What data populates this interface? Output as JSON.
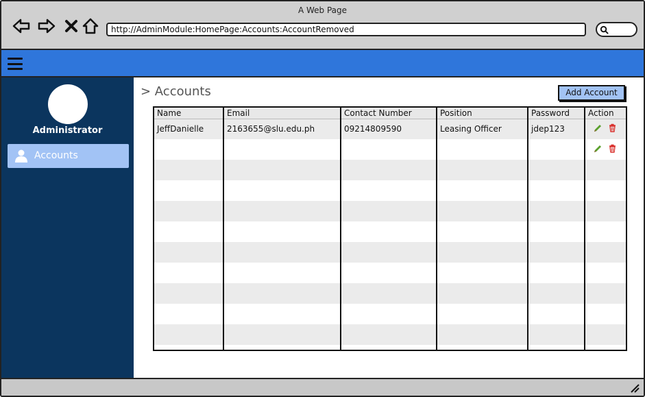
{
  "window": {
    "title": "A Web Page"
  },
  "browser": {
    "url": "http://AdminModule:HomePage:Accounts:AccountRemoved",
    "icons": [
      "back-arrow-icon",
      "forward-arrow-icon",
      "close-x-icon",
      "home-icon",
      "search-icon"
    ]
  },
  "colors": {
    "header_blue": "#2f76db",
    "sidebar_navy": "#0b355e",
    "accent_light_blue": "#a2c3f5",
    "edit_green": "#5aa02c",
    "delete_red": "#d9302c"
  },
  "sidebar": {
    "user_label": "Administrator",
    "items": [
      {
        "label": "Accounts",
        "icon": "user-icon",
        "active": true
      }
    ]
  },
  "main": {
    "breadcrumb": "> Accounts",
    "add_button_label": "Add Account",
    "table": {
      "columns": [
        "Name",
        "Email",
        "Contact Number",
        "Position",
        "Password",
        "Action"
      ],
      "rows": [
        {
          "name": "JeffDanielle",
          "email": "2163655@slu.edu.ph",
          "contact": "09214809590",
          "position": "Leasing Officer",
          "password": "jdep123",
          "actions": [
            "edit-icon",
            "delete-icon"
          ]
        },
        {
          "name": "",
          "email": "",
          "contact": "",
          "position": "",
          "password": "",
          "actions": [
            "edit-icon",
            "delete-icon"
          ]
        },
        {
          "name": "",
          "email": "",
          "contact": "",
          "position": "",
          "password": "",
          "actions": []
        },
        {
          "name": "",
          "email": "",
          "contact": "",
          "position": "",
          "password": "",
          "actions": []
        },
        {
          "name": "",
          "email": "",
          "contact": "",
          "position": "",
          "password": "",
          "actions": []
        },
        {
          "name": "",
          "email": "",
          "contact": "",
          "position": "",
          "password": "",
          "actions": []
        },
        {
          "name": "",
          "email": "",
          "contact": "",
          "position": "",
          "password": "",
          "actions": []
        },
        {
          "name": "",
          "email": "",
          "contact": "",
          "position": "",
          "password": "",
          "actions": []
        },
        {
          "name": "",
          "email": "",
          "contact": "",
          "position": "",
          "password": "",
          "actions": []
        },
        {
          "name": "",
          "email": "",
          "contact": "",
          "position": "",
          "password": "",
          "actions": []
        },
        {
          "name": "",
          "email": "",
          "contact": "",
          "position": "",
          "password": "",
          "actions": []
        },
        {
          "name": "",
          "email": "",
          "contact": "",
          "position": "",
          "password": "",
          "actions": []
        }
      ]
    }
  }
}
